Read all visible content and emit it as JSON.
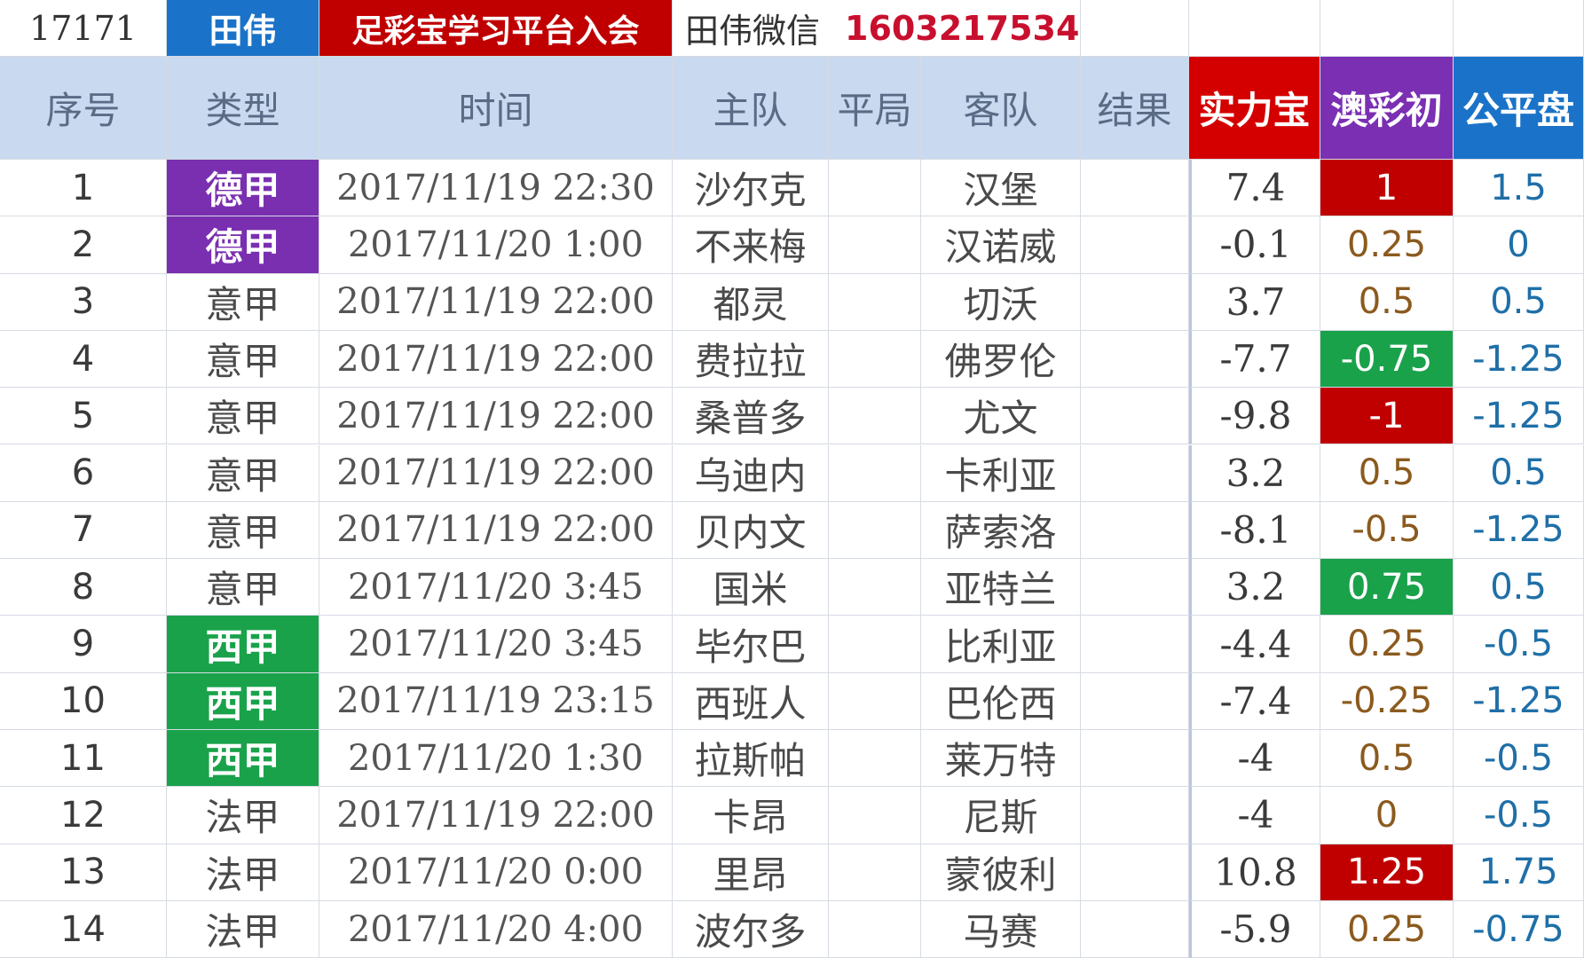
{
  "top_bar": {
    "id": "17171",
    "name": "田伟",
    "banner": "足彩宝学习平台入会",
    "wechat_label": "田伟微信",
    "phone": "1603217534"
  },
  "headers": {
    "index": "序号",
    "type": "类型",
    "time": "时间",
    "home": "主队",
    "draw": "平局",
    "away": "客队",
    "result": "结果",
    "strength": "实力宝",
    "aucai": "澳彩初",
    "fair": "公平盘"
  },
  "colors": {
    "header_bg": "#c9d9ef",
    "strength_header": "#d40000",
    "aucai_header": "#7b2fb3",
    "fair_header": "#1a73c8",
    "bundesliga": "#7a2fb0",
    "laliga": "#1aa24b",
    "highlight_red": "#c00000",
    "highlight_green": "#1aa24b"
  },
  "rows": [
    {
      "index": "1",
      "league": "德甲",
      "time": "2017/11/19 22:30",
      "home": "沙尔克",
      "away": "汉堡",
      "strength": "7.4",
      "aucai": "1",
      "fair": "1.5"
    },
    {
      "index": "2",
      "league": "德甲",
      "time": "2017/11/20 1:00",
      "home": "不来梅",
      "away": "汉诺威",
      "strength": "-0.1",
      "aucai": "0.25",
      "fair": "0"
    },
    {
      "index": "3",
      "league": "意甲",
      "time": "2017/11/19 22:00",
      "home": "都灵",
      "away": "切沃",
      "strength": "3.7",
      "aucai": "0.5",
      "fair": "0.5"
    },
    {
      "index": "4",
      "league": "意甲",
      "time": "2017/11/19 22:00",
      "home": "费拉拉",
      "away": "佛罗伦",
      "strength": "-7.7",
      "aucai": "-0.75",
      "fair": "-1.25"
    },
    {
      "index": "5",
      "league": "意甲",
      "time": "2017/11/19 22:00",
      "home": "桑普多",
      "away": "尤文",
      "strength": "-9.8",
      "aucai": "-1",
      "fair": "-1.25"
    },
    {
      "index": "6",
      "league": "意甲",
      "time": "2017/11/19 22:00",
      "home": "乌迪内",
      "away": "卡利亚",
      "strength": "3.2",
      "aucai": "0.5",
      "fair": "0.5"
    },
    {
      "index": "7",
      "league": "意甲",
      "time": "2017/11/19 22:00",
      "home": "贝内文",
      "away": "萨索洛",
      "strength": "-8.1",
      "aucai": "-0.5",
      "fair": "-1.25"
    },
    {
      "index": "8",
      "league": "意甲",
      "time": "2017/11/20 3:45",
      "home": "国米",
      "away": "亚特兰",
      "strength": "3.2",
      "aucai": "0.75",
      "fair": "0.5"
    },
    {
      "index": "9",
      "league": "西甲",
      "time": "2017/11/20 3:45",
      "home": "毕尔巴",
      "away": "比利亚",
      "strength": "-4.4",
      "aucai": "0.25",
      "fair": "-0.5"
    },
    {
      "index": "10",
      "league": "西甲",
      "time": "2017/11/19 23:15",
      "home": "西班人",
      "away": "巴伦西",
      "strength": "-7.4",
      "aucai": "-0.25",
      "fair": "-1.25"
    },
    {
      "index": "11",
      "league": "西甲",
      "time": "2017/11/20 1:30",
      "home": "拉斯帕",
      "away": "莱万特",
      "strength": "-4",
      "aucai": "0.5",
      "fair": "-0.5"
    },
    {
      "index": "12",
      "league": "法甲",
      "time": "2017/11/19 22:00",
      "home": "卡昂",
      "away": "尼斯",
      "strength": "-4",
      "aucai": "0",
      "fair": "-0.5"
    },
    {
      "index": "13",
      "league": "法甲",
      "time": "2017/11/20 0:00",
      "home": "里昂",
      "away": "蒙彼利",
      "strength": "10.8",
      "aucai": "1.25",
      "fair": "1.75"
    },
    {
      "index": "14",
      "league": "法甲",
      "time": "2017/11/20 4:00",
      "home": "波尔多",
      "away": "马赛",
      "strength": "-5.9",
      "aucai": "0.25",
      "fair": "-0.75"
    }
  ],
  "league_styles": {
    "德甲": "lg-de",
    "西甲": "lg-xi"
  },
  "aucai_highlights": {
    "0": "au-red",
    "3": "au-green",
    "4": "au-red",
    "7": "au-green",
    "12": "au-red"
  }
}
